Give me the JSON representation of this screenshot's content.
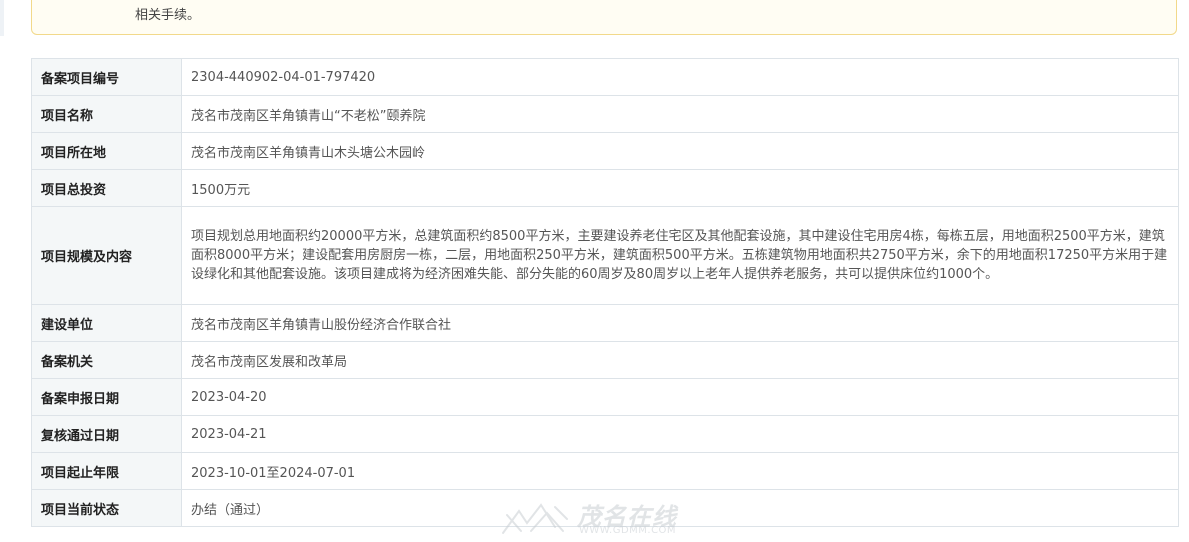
{
  "notice": {
    "text": "相关手续。"
  },
  "records": [
    {
      "label": "备案项目编号",
      "value": "2304-440902-04-01-797420"
    },
    {
      "label": "项目名称",
      "value": "茂名市茂南区羊角镇青山“不老松”颐养院"
    },
    {
      "label": "项目所在地",
      "value": "茂名市茂南区羊角镇青山木头塘公木园岭"
    },
    {
      "label": "项目总投资",
      "value": "1500万元"
    },
    {
      "label": "项目规模及内容",
      "value": "项目规划总用地面积约20000平方米，总建筑面积约8500平方米，主要建设养老住宅区及其他配套设施，其中建设住宅用房4栋，每栋五层，用地面积2500平方米，建筑面积8000平方米；建设配套用房厨房一栋，二层，用地面积250平方米，建筑面积500平方米。五栋建筑物用地面积共2750平方米，余下的用地面积17250平方米用于建设绿化和其他配套设施。该项目建成将为经济困难失能、部分失能的60周岁及80周岁以上老年人提供养老服务，共可以提供床位约1000个。"
    },
    {
      "label": "建设单位",
      "value": "茂名市茂南区羊角镇青山股份经济合作联合社"
    },
    {
      "label": "备案机关",
      "value": "茂名市茂南区发展和改革局"
    },
    {
      "label": "备案申报日期",
      "value": "2023-04-20"
    },
    {
      "label": "复核通过日期",
      "value": "2023-04-21"
    },
    {
      "label": "项目起止年限",
      "value": "2023-10-01至2024-07-01"
    },
    {
      "label": "项目当前状态",
      "value": "办结（通过）"
    }
  ],
  "watermark": {
    "brand": "茂名在线",
    "url": "WWW.GDMM.COM"
  }
}
